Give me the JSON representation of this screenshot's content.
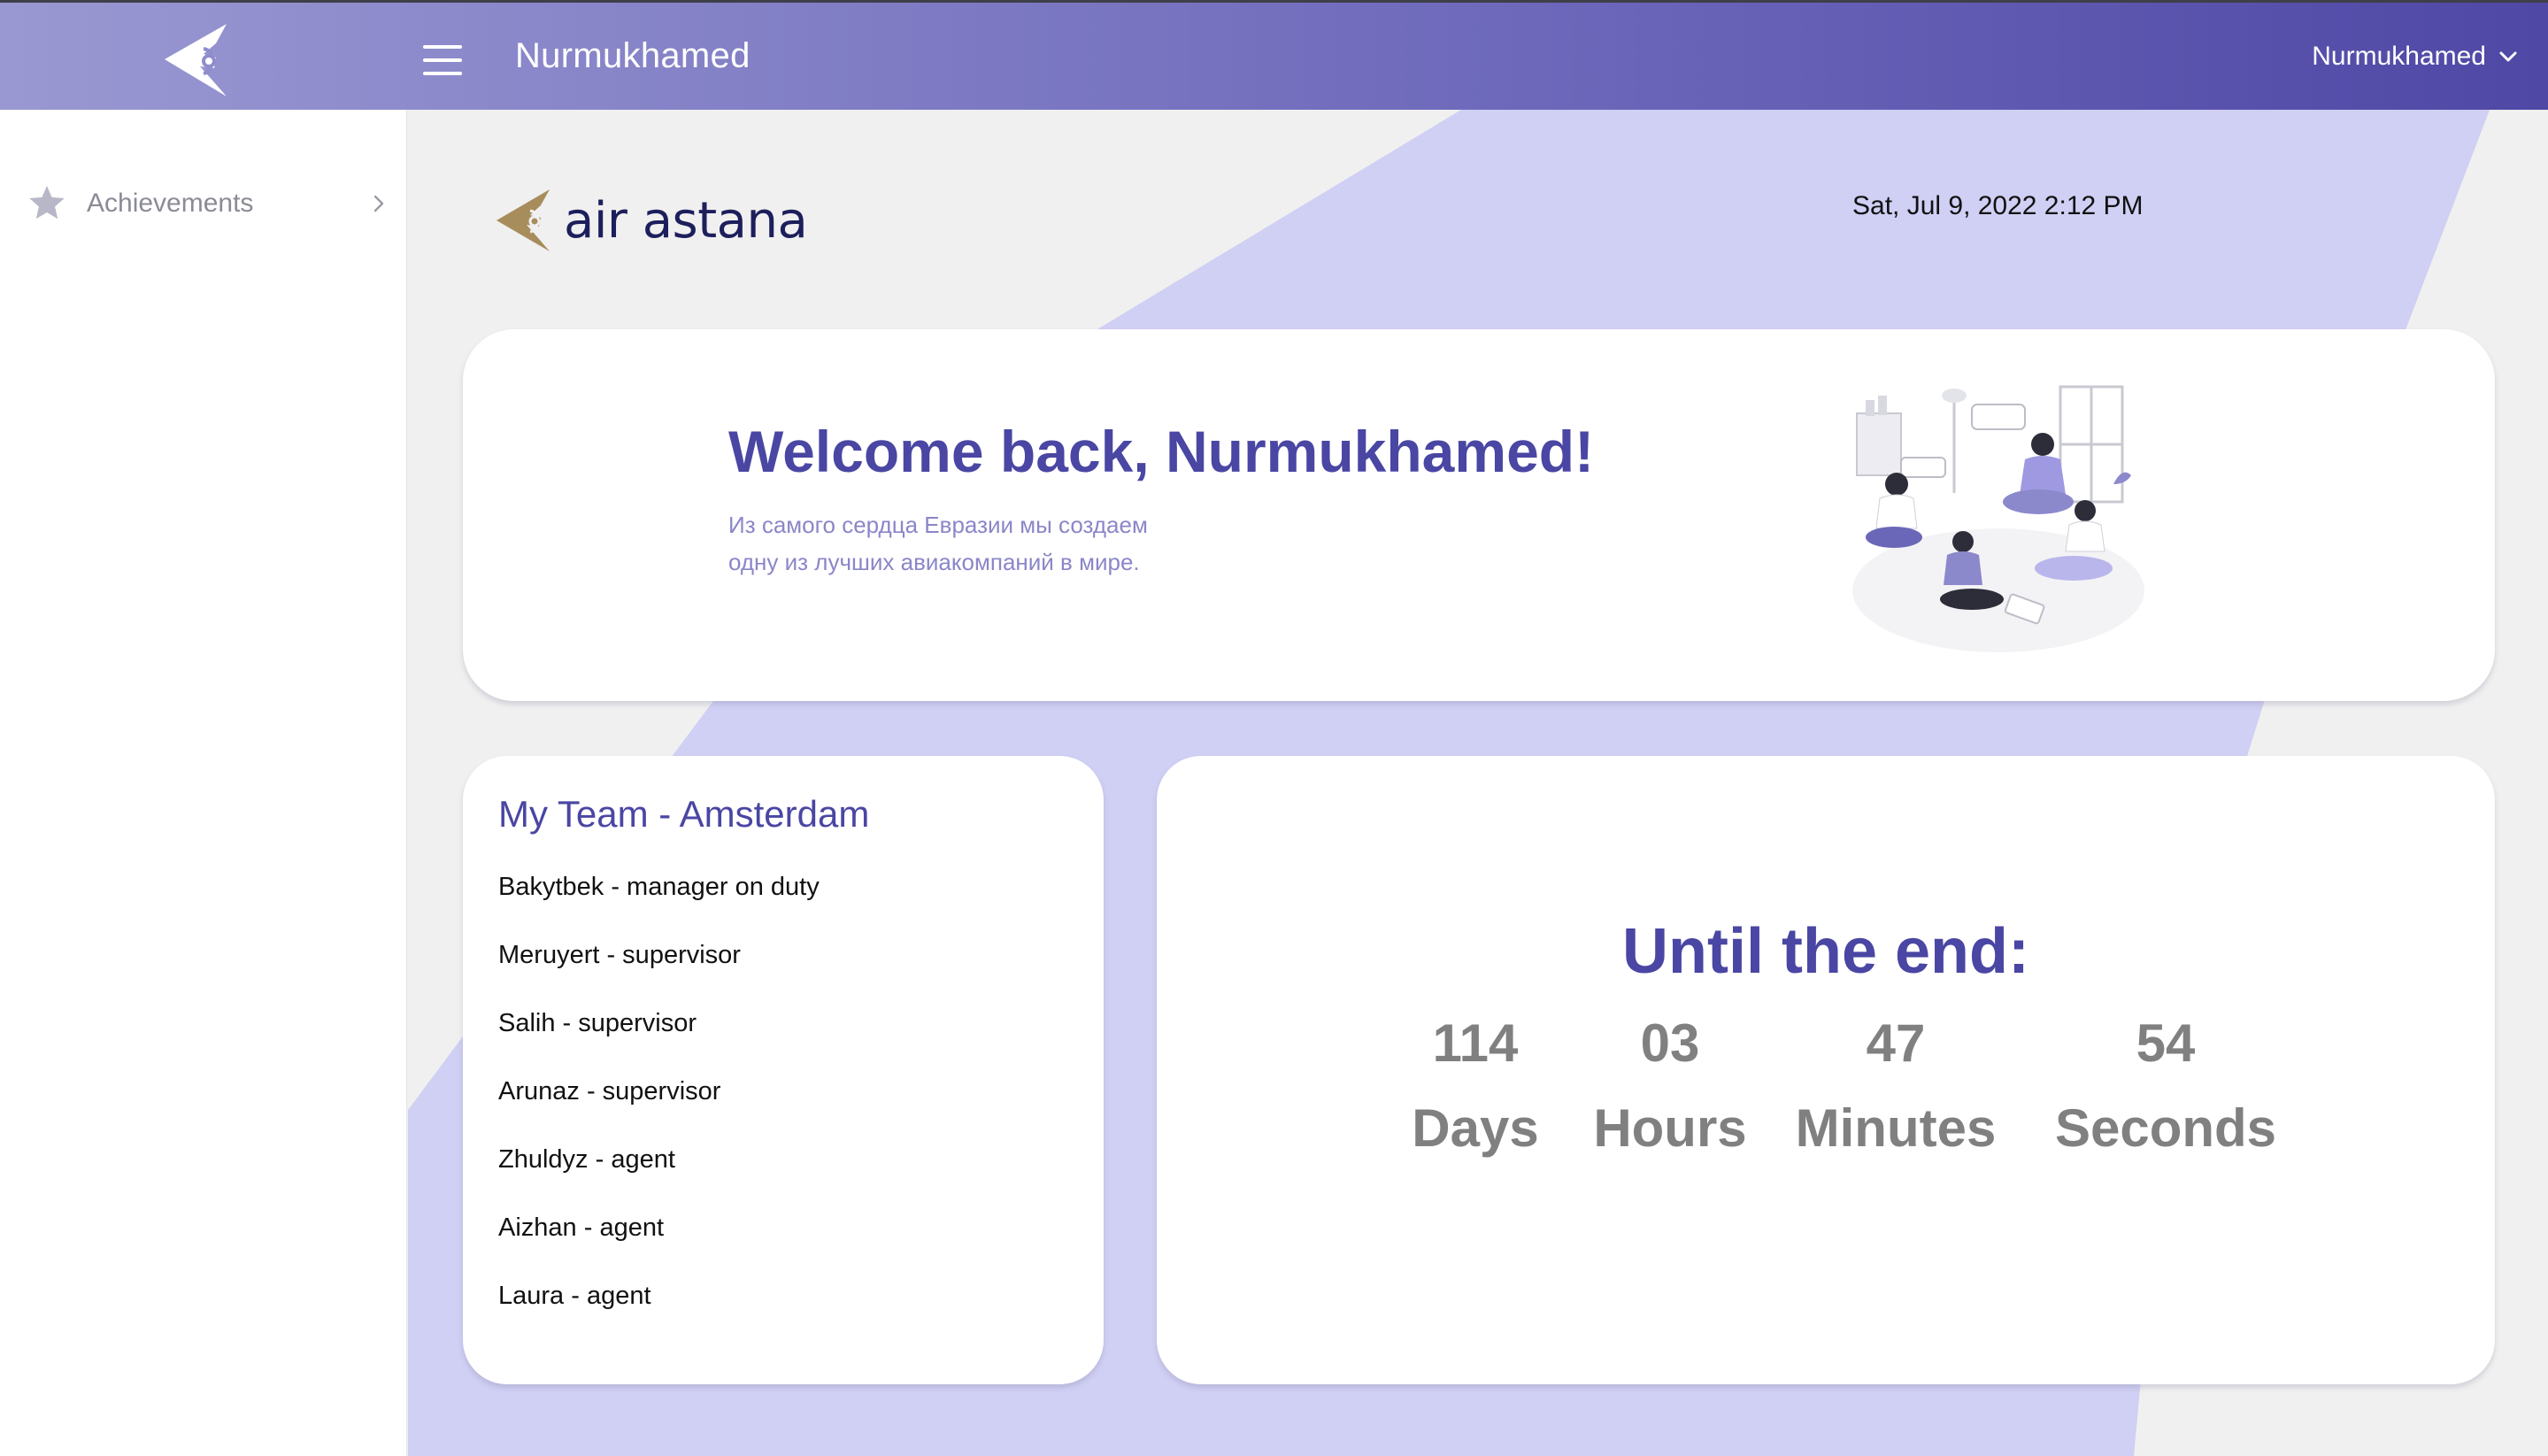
{
  "header": {
    "title": "Nurmukhamed",
    "user_name": "Nurmukhamed",
    "menu_icon": "hamburger-icon",
    "user_menu_icon": "chevron-down-icon",
    "brand_icon": "air-astana-icon"
  },
  "sidebar": {
    "items": [
      {
        "label": "Achievements",
        "icon": "star-icon",
        "arrow": "chevron-right-icon"
      }
    ]
  },
  "main": {
    "logo_text": "air astana",
    "datetime": "Sat, Jul 9, 2022 2:12 PM",
    "welcome": {
      "title": "Welcome back, Nurmukhamed!",
      "subtitle_line1": "Из самого сердца Евразии мы создаем",
      "subtitle_line2": "одну из лучших авиакомпаний в мире."
    },
    "team": {
      "title": "My Team - Amsterdam",
      "members": [
        "Bakytbek - manager on duty",
        "Meruyert - supervisor",
        "Salih - supervisor",
        "Arunaz - supervisor",
        "Zhuldyz - agent",
        "Aizhan - agent",
        "Laura - agent"
      ]
    },
    "countdown": {
      "title": "Until the end:",
      "days": "114",
      "days_label": "Days",
      "hours": "03",
      "hours_label": "Hours",
      "minutes": "47",
      "minutes_label": "Minutes",
      "seconds": "54",
      "seconds_label": "Seconds"
    }
  },
  "colors": {
    "accent": "#4a46a3",
    "header_start": "#9a98d2",
    "header_end": "#4f48a5",
    "band": "#d0cff4",
    "muted": "#808080"
  }
}
